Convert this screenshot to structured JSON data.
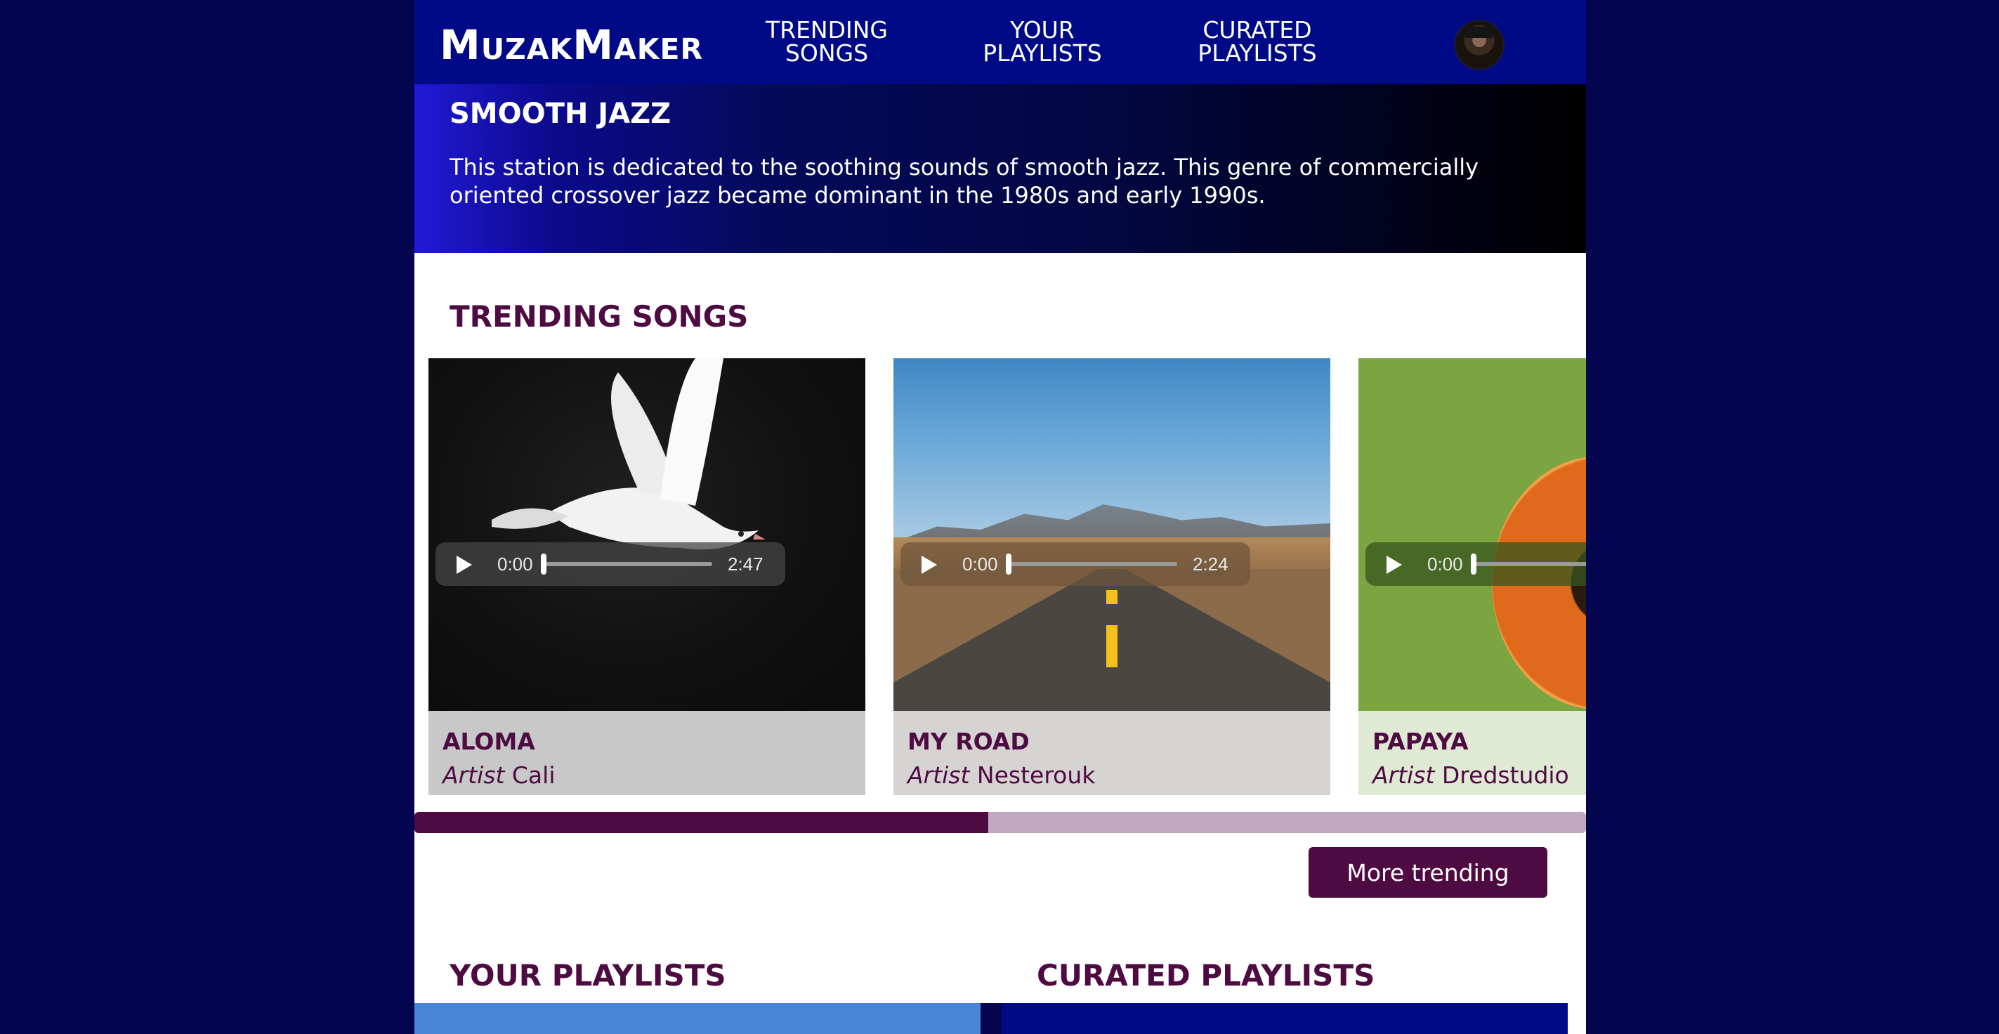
{
  "app": {
    "logo": "MuzakMaker"
  },
  "nav": [
    {
      "line1": "TRENDING",
      "line2": "SONGS"
    },
    {
      "line1": "YOUR",
      "line2": "PLAYLISTS"
    },
    {
      "line1": "CURATED",
      "line2": "PLAYLISTS"
    }
  ],
  "hero": {
    "title": "SMOOTH JAZZ",
    "description": "This station is dedicated to the soothing sounds of smooth jazz. This genre of commercially oriented crossover jazz became dominant in the 1980s and early 1990s."
  },
  "trending": {
    "title": "TRENDING SONGS",
    "artist_label": "Artist",
    "songs": [
      {
        "title": "ALOMA",
        "artist": "Cali",
        "current_time": "0:00",
        "duration": "2:47",
        "image": "dove"
      },
      {
        "title": "MY ROAD",
        "artist": "Nesterouk",
        "current_time": "0:00",
        "duration": "2:24",
        "image": "road"
      },
      {
        "title": "PAPAYA",
        "artist": "Dredstudio",
        "current_time": "0:00",
        "duration": "",
        "image": "papaya"
      }
    ],
    "scroll_progress": 0.49,
    "more_button": "More trending"
  },
  "sections": {
    "your_playlists": "YOUR PLAYLISTS",
    "curated_playlists": "CURATED PLAYLISTS"
  },
  "colors": {
    "page_bg": "#03064f",
    "header_bg": "#000a87",
    "accent": "#4d0b42"
  }
}
